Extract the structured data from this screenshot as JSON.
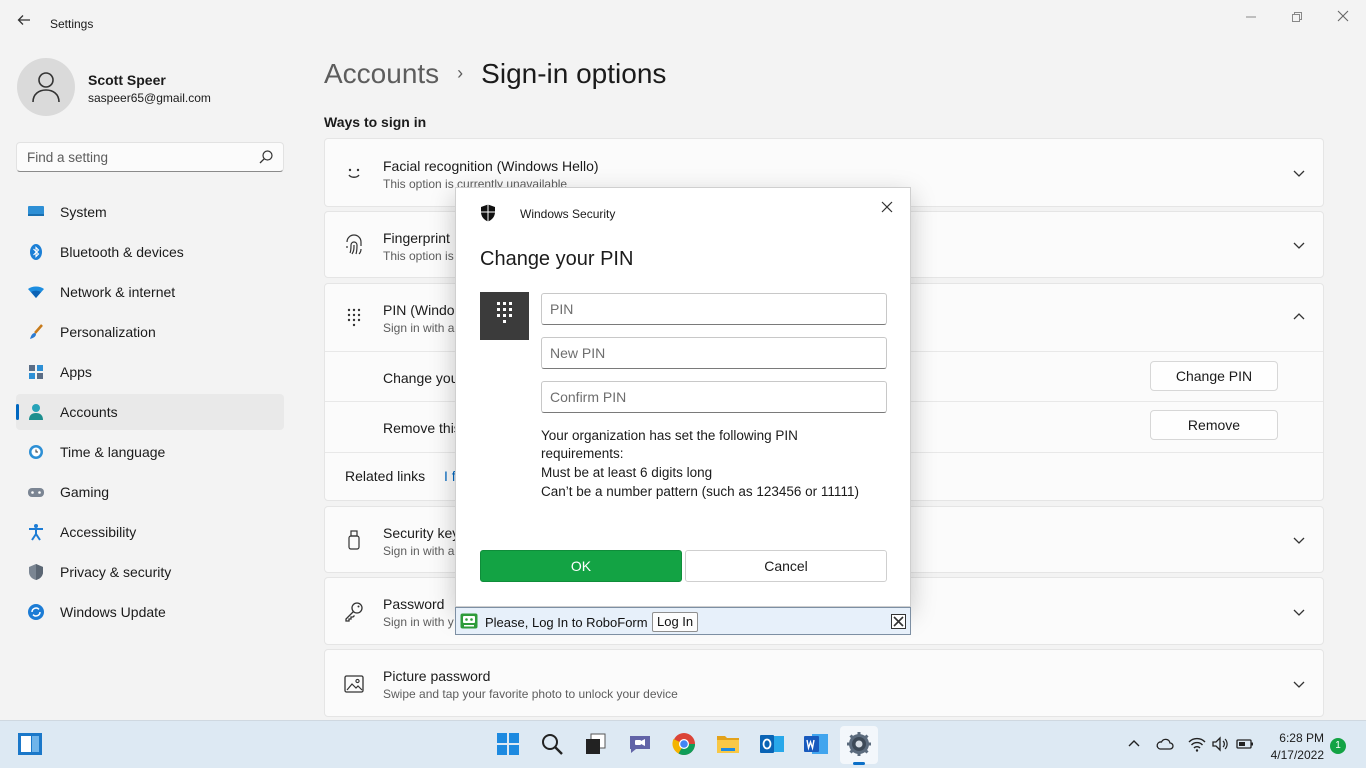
{
  "window": {
    "title": "Settings",
    "back_icon": "back-arrow-icon",
    "controls": [
      "minimize-icon",
      "maximize-icon",
      "close-icon"
    ]
  },
  "user": {
    "name": "Scott Speer",
    "email": "saspeer65@gmail.com"
  },
  "search": {
    "placeholder": "Find a setting"
  },
  "sidebar": {
    "items": [
      {
        "label": "System",
        "icon": "display-icon"
      },
      {
        "label": "Bluetooth & devices",
        "icon": "bluetooth-icon"
      },
      {
        "label": "Network & internet",
        "icon": "wifi-icon"
      },
      {
        "label": "Personalization",
        "icon": "brush-icon"
      },
      {
        "label": "Apps",
        "icon": "apps-icon"
      },
      {
        "label": "Accounts",
        "icon": "person-icon",
        "active": true
      },
      {
        "label": "Time & language",
        "icon": "clock-globe-icon"
      },
      {
        "label": "Gaming",
        "icon": "gamepad-icon"
      },
      {
        "label": "Accessibility",
        "icon": "accessibility-icon"
      },
      {
        "label": "Privacy & security",
        "icon": "shield-icon"
      },
      {
        "label": "Windows Update",
        "icon": "update-icon"
      }
    ]
  },
  "main": {
    "breadcrumb_parent": "Accounts",
    "breadcrumb_current": "Sign-in options",
    "section_title": "Ways to sign in",
    "cards": {
      "facial": {
        "title": "Facial recognition (Windows Hello)",
        "subtitle": "This option is currently unavailable"
      },
      "fingerprint": {
        "title": "Fingerprint",
        "subtitle": "This option is"
      },
      "pin": {
        "title": "PIN (Windo",
        "subtitle": "Sign in with a",
        "change_label": "Change you",
        "change_button": "Change PIN",
        "remove_label": "Remove this",
        "remove_button": "Remove",
        "related_label": "Related links",
        "related_link": "I f"
      },
      "security_key": {
        "title": "Security key",
        "subtitle": "Sign in with a"
      },
      "password": {
        "title": "Password",
        "subtitle": "Sign in with y"
      },
      "picture_password": {
        "title": "Picture password",
        "subtitle": "Swipe and tap your favorite photo to unlock your device"
      }
    }
  },
  "dialog": {
    "app_name": "Windows Security",
    "title": "Change your PIN",
    "pin_placeholder": "PIN",
    "new_pin_placeholder": "New PIN",
    "confirm_pin_placeholder": "Confirm PIN",
    "requirements": [
      "Your organization has set the following PIN",
      "requirements:",
      "Must be at least 6 digits long",
      "Can’t be a number pattern (such as 123456 or 11111)"
    ],
    "ok": "OK",
    "cancel": "Cancel"
  },
  "roboform": {
    "message": "Please, Log In to RoboForm",
    "login_button": "Log In"
  },
  "taskbar": {
    "apps": [
      "windows-start-icon",
      "start-icon",
      "search-icon",
      "task-view-icon",
      "teams-chat-icon",
      "chrome-icon",
      "file-explorer-icon",
      "outlook-icon",
      "word-icon",
      "settings-icon"
    ],
    "time": "6:28 PM",
    "date": "4/17/2022",
    "notification_count": "1"
  },
  "colors": {
    "accent": "#0067c0",
    "ok_button": "#13a344",
    "taskbar": "#dde9f3"
  }
}
